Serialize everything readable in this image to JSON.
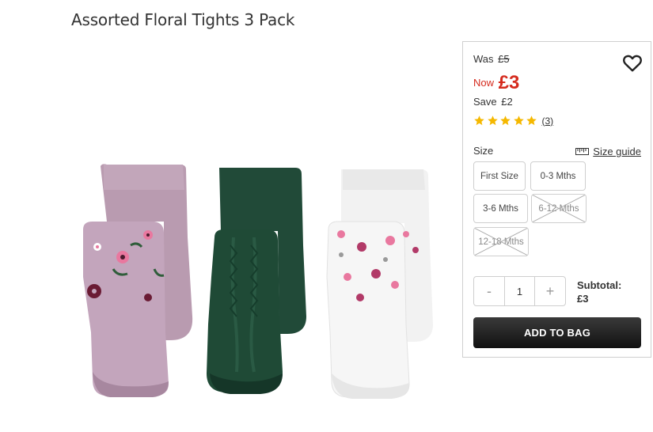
{
  "product": {
    "title": "Assorted Floral Tights 3 Pack"
  },
  "price": {
    "was_label": "Was",
    "was_value": "£5",
    "now_label": "Now",
    "now_value": "£3",
    "save_label": "Save",
    "save_value": "£2",
    "accent_color": "#d52b1e"
  },
  "rating": {
    "stars": 5,
    "max": 5,
    "review_count": "(3)",
    "star_color": "#f5b800"
  },
  "wishlist": {
    "icon": "heart-icon"
  },
  "size": {
    "label": "Size",
    "guide_label": "Size guide",
    "guide_icon": "ruler-icon",
    "options": [
      {
        "label": "First Size",
        "available": true
      },
      {
        "label": "0-3 Mths",
        "available": true
      },
      {
        "label": "3-6 Mths",
        "available": true
      },
      {
        "label": "6-12 Mths",
        "available": false
      },
      {
        "label": "12-18 Mths",
        "available": false
      }
    ]
  },
  "quantity": {
    "minus": "-",
    "value": "1",
    "plus": "+"
  },
  "subtotal": {
    "label": "Subtotal:",
    "value": "£3"
  },
  "cart": {
    "add_label": "ADD TO BAG"
  }
}
